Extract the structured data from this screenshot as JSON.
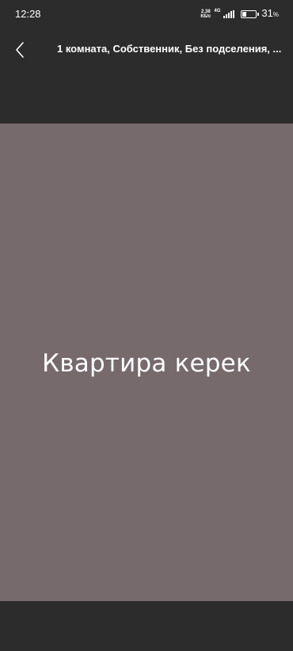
{
  "status_bar": {
    "time": "12:28",
    "net_speed_value": "2.38",
    "net_speed_unit": "КБ/с",
    "net_type": "4G",
    "battery_level": 0.31,
    "battery_percent": "31",
    "battery_percent_sign": "%"
  },
  "header": {
    "back_icon": "chevron-left-icon",
    "title": "1 комната, Собственник, Без подселения, ..."
  },
  "image": {
    "background_color": "#766a6d",
    "text": "Квартира керек"
  },
  "colors": {
    "background": "#2c2c2c",
    "text": "#ffffff"
  }
}
